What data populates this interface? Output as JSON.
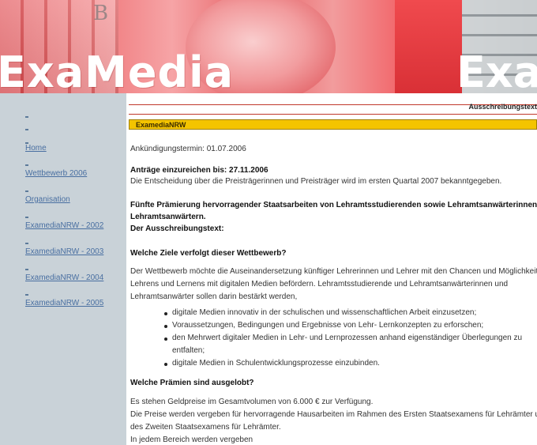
{
  "banner": {
    "logo_left": "ExaMedia",
    "logo_right": "Exa",
    "key_glyph_1": "B",
    "key_glyph_2": "&"
  },
  "sidebar": {
    "items": [
      {
        "label": "Home"
      },
      {
        "label": "Wettbewerb 2006"
      },
      {
        "label": "Organisation"
      },
      {
        "label": "ExamediaNRW - 2002"
      },
      {
        "label": "ExamediaNRW - 2003"
      },
      {
        "label": "ExamediaNRW - 2004"
      },
      {
        "label": "ExamediaNRW - 2005"
      }
    ]
  },
  "main": {
    "header_right": "Ausschreibungstext",
    "section_bar": "ExamediaNRW",
    "announce": "Ankündigungstermin: 01.07.2006",
    "deadline": "Anträge einzureichen bis: 27.11.2006",
    "decision": "Die Entscheidung über die Preisträgerinnen und Preisträger wird im ersten Quartal 2007 bekanntgegeben.",
    "fifth_line1": "Fünfte Prämierung hervorragender Staatsarbeiten von Lehramtsstudierenden sowie Lehramtsanwärterinnen und",
    "fifth_line2": "Lehramtsanwärtern.",
    "text_label": "Der Ausschreibungstext:",
    "goals_q": "Welche Ziele verfolgt dieser Wettbewerb?",
    "goals_p1": "Der Wettbewerb möchte die Auseinandersetzung künftiger Lehrerinnen und Lehrer mit den Chancen und Möglichkeiten des",
    "goals_p2": "Lehrens und Lernens mit digitalen Medien befördern. Lehramtsstudierende und Lehramtsanwärterinnen und",
    "goals_p3": "Lehramtsanwärter sollen darin bestärkt werden,",
    "points": [
      "digitale Medien innovativ in der schulischen und wissenschaftlichen Arbeit einzusetzen;",
      "Voraussetzungen, Bedingungen und Ergebnisse von Lehr- Lernkonzepten zu erforschen;",
      "den Mehrwert digitaler Medien in Lehr- und Lernprozessen anhand eigenständiger Überlegungen zu",
      "entfalten;",
      "digitale Medien in Schulentwicklungsprozesse einzubinden."
    ],
    "prizes_q": "Welche Prämien sind ausgelobt?",
    "prizes_p1": "Es stehen Geldpreise im Gesamtvolumen von 6.000 € zur Verfügung.",
    "prizes_p2": "Die Preise werden vergeben für hervorragende Hausarbeiten im Rahmen des Ersten Staatsexamens für Lehrämter und",
    "prizes_p3": "des Zweiten Staatsexamens für Lehrämter.",
    "prizes_p4": "In jedem Bereich werden vergeben"
  }
}
